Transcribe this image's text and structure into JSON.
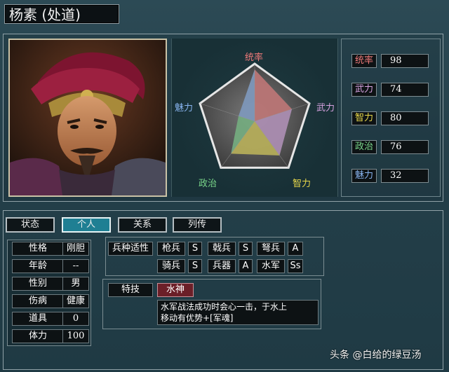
{
  "general": {
    "name": "杨素 (处道)"
  },
  "stats": [
    {
      "label": "统率",
      "value": "98",
      "color": "#f07a7a"
    },
    {
      "label": "武力",
      "value": "74",
      "color": "#d6a2e0"
    },
    {
      "label": "智力",
      "value": "80",
      "color": "#e8d84a"
    },
    {
      "label": "政治",
      "value": "76",
      "color": "#79d68a"
    },
    {
      "label": "魅力",
      "value": "32",
      "color": "#88b4f0"
    }
  ],
  "radar": {
    "labels": {
      "top": "统率",
      "right": "武力",
      "bottom_right": "智力",
      "bottom_left": "政治",
      "left": "魅力"
    }
  },
  "tabs": [
    {
      "label": "状态",
      "active": false
    },
    {
      "label": "个人",
      "active": true
    },
    {
      "label": "关系",
      "active": false
    },
    {
      "label": "列传",
      "active": false
    }
  ],
  "personal": [
    {
      "label": "性格",
      "value": "刚胆"
    },
    {
      "label": "年龄",
      "value": "--"
    },
    {
      "label": "性别",
      "value": "男"
    },
    {
      "label": "伤病",
      "value": "健康"
    },
    {
      "label": "道具",
      "value": "0"
    },
    {
      "label": "体力",
      "value": "100"
    }
  ],
  "aptitude": {
    "title": "兵种适性",
    "rows": [
      [
        {
          "unit": "枪兵",
          "grade": "S"
        },
        {
          "unit": "戟兵",
          "grade": "S"
        },
        {
          "unit": "弩兵",
          "grade": "A"
        }
      ],
      [
        {
          "unit": "骑兵",
          "grade": "S"
        },
        {
          "unit": "兵器",
          "grade": "A"
        },
        {
          "unit": "水军",
          "grade": "Ss"
        }
      ]
    ]
  },
  "skill": {
    "title": "特技",
    "name": "水神",
    "description_line1": "水军战法成功时会心一击，于水上",
    "description_line2": "移动有优势+[军魂]"
  },
  "watermark": "头条 @白给的绿豆汤",
  "colors": {
    "active_tab": "#1f7f93",
    "skill_highlight": "#6b1f28"
  }
}
